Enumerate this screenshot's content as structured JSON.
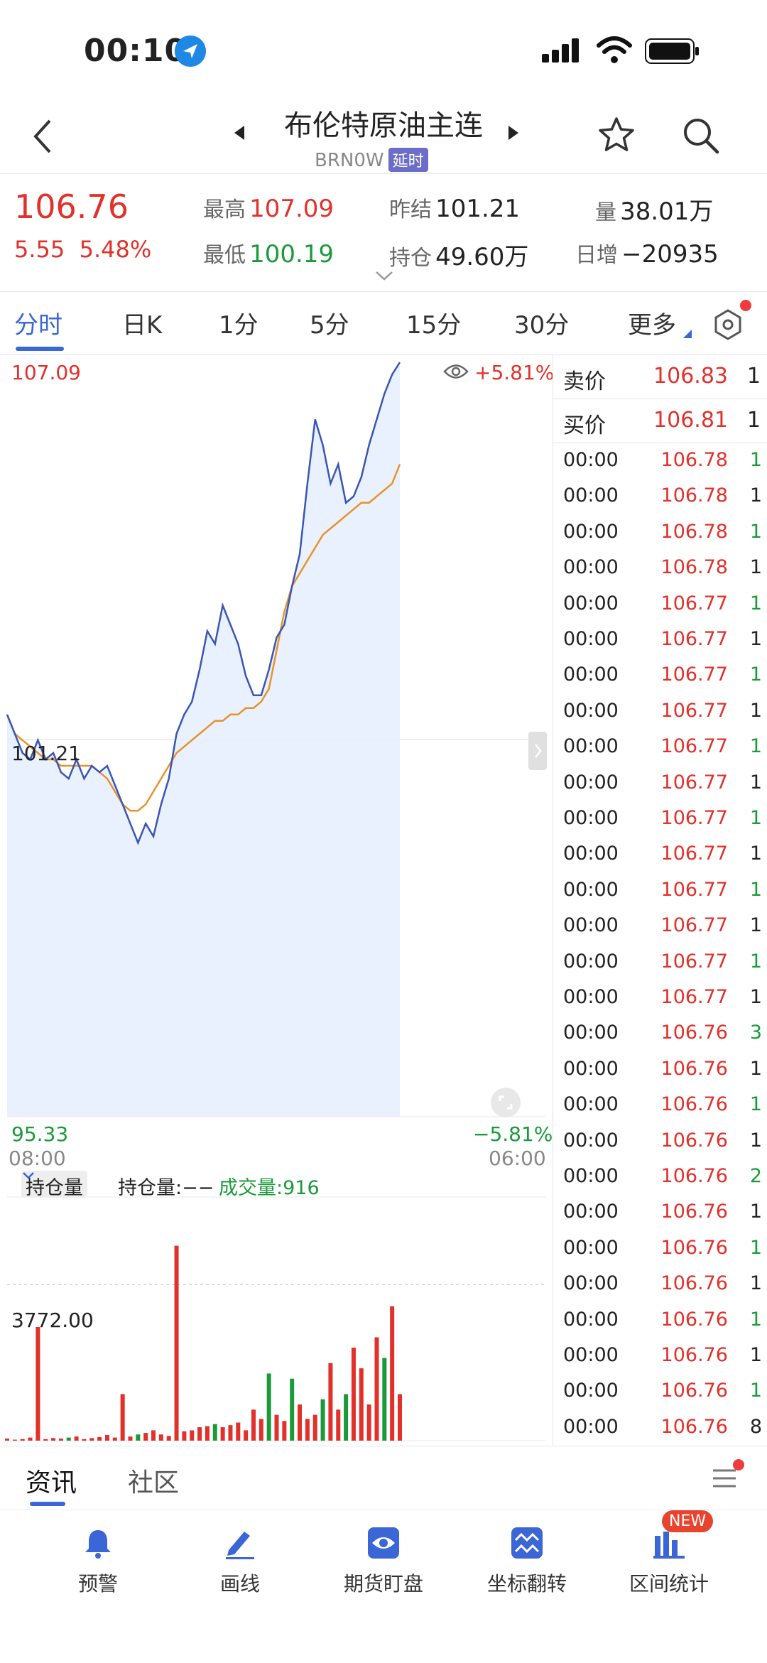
{
  "status": {
    "time": "00:10"
  },
  "header": {
    "title": "布伦特原油主连",
    "code": "BRN0W",
    "badge": "延时"
  },
  "quote": {
    "last": "106.76",
    "change": "5.55",
    "change_pct": "5.48%",
    "high_label": "最高",
    "high": "107.09",
    "low_label": "最低",
    "low": "100.19",
    "prev_label": "昨结",
    "prev": "101.21",
    "oi_label": "持仓",
    "oi": "49.60万",
    "vol_label": "量",
    "vol": "38.01万",
    "dinc_label": "日增",
    "dinc": "−20935"
  },
  "tabs": [
    "分时",
    "日K",
    "1分",
    "5分",
    "15分",
    "30分",
    "更多"
  ],
  "chart": {
    "top_label": "107.09",
    "top_pct": "+5.81%",
    "mid_label": "101.21",
    "bottom_label": "95.33",
    "bottom_pct": "−5.81%",
    "time_start": "08:00",
    "time_end": "06:00",
    "vol_selector": "持仓量",
    "oi_text": "持仓量:−−",
    "vol_text": "成交量:916",
    "vol_ref": "3772.00"
  },
  "chart_data": {
    "type": "line",
    "y_range": [
      95.33,
      107.09
    ],
    "prev_close": 101.21,
    "series": [
      {
        "values": [
          101.6,
          101.3,
          101.0,
          100.9,
          101.2,
          100.9,
          101.0,
          100.7,
          100.6,
          100.9,
          100.6,
          100.8,
          100.7,
          100.8,
          100.5,
          100.2,
          99.9,
          99.6,
          99.9,
          99.7,
          100.2,
          100.6,
          101.3,
          101.6,
          101.8,
          102.3,
          102.9,
          102.7,
          103.3,
          103.0,
          102.7,
          102.2,
          101.9,
          101.9,
          102.3,
          102.8,
          103.0,
          103.6,
          104.1,
          105.2,
          106.2,
          105.8,
          105.2,
          105.5,
          104.9,
          105.0,
          105.3,
          105.8,
          106.2,
          106.6,
          106.9,
          107.09
        ]
      },
      {
        "values": [
          101.6,
          101.3,
          101.2,
          101.1,
          101.0,
          100.9,
          100.9,
          100.8,
          100.8,
          100.8,
          100.8,
          100.8,
          100.7,
          100.6,
          100.4,
          100.2,
          100.1,
          100.1,
          100.2,
          100.4,
          100.6,
          100.8,
          101.0,
          101.1,
          101.2,
          101.3,
          101.4,
          101.5,
          101.5,
          101.6,
          101.6,
          101.7,
          101.7,
          101.8,
          102.0,
          102.6,
          103.2,
          103.6,
          103.8,
          104.0,
          104.2,
          104.4,
          104.5,
          104.6,
          104.7,
          104.8,
          104.9,
          104.9,
          105.0,
          105.1,
          105.2,
          105.5
        ]
      }
    ],
    "volume": [
      40,
      20,
      30,
      60,
      2200,
      30,
      50,
      40,
      60,
      80,
      30,
      50,
      70,
      110,
      60,
      900,
      80,
      120,
      150,
      200,
      120,
      90,
      3772,
      180,
      200,
      260,
      280,
      320,
      260,
      300,
      350,
      200,
      600,
      420,
      1300,
      500,
      380,
      1200,
      700,
      420,
      500,
      800,
      1500,
      600,
      900,
      1800,
      1400,
      700,
      2000,
      1600,
      2600,
      900
    ],
    "volume_colors": [
      "r",
      "r",
      "r",
      "r",
      "r",
      "r",
      "r",
      "r",
      "g",
      "r",
      "r",
      "r",
      "r",
      "r",
      "r",
      "r",
      "r",
      "g",
      "r",
      "r",
      "r",
      "r",
      "r",
      "r",
      "r",
      "r",
      "r",
      "g",
      "r",
      "r",
      "r",
      "r",
      "r",
      "r",
      "g",
      "r",
      "r",
      "g",
      "r",
      "r",
      "r",
      "g",
      "r",
      "r",
      "g",
      "r",
      "r",
      "r",
      "r",
      "g",
      "r",
      "r"
    ]
  },
  "trades": {
    "ask": {
      "label": "卖价",
      "price": "106.83",
      "vol": "1"
    },
    "bid": {
      "label": "买价",
      "price": "106.81",
      "vol": "1"
    },
    "rows": [
      {
        "t": "00:00",
        "p": "106.78",
        "v": "1"
      },
      {
        "t": "00:00",
        "p": "106.78",
        "v": "1"
      },
      {
        "t": "00:00",
        "p": "106.78",
        "v": "1"
      },
      {
        "t": "00:00",
        "p": "106.78",
        "v": "1"
      },
      {
        "t": "00:00",
        "p": "106.77",
        "v": "1"
      },
      {
        "t": "00:00",
        "p": "106.77",
        "v": "1"
      },
      {
        "t": "00:00",
        "p": "106.77",
        "v": "1"
      },
      {
        "t": "00:00",
        "p": "106.77",
        "v": "1"
      },
      {
        "t": "00:00",
        "p": "106.77",
        "v": "1"
      },
      {
        "t": "00:00",
        "p": "106.77",
        "v": "1"
      },
      {
        "t": "00:00",
        "p": "106.77",
        "v": "1"
      },
      {
        "t": "00:00",
        "p": "106.77",
        "v": "1"
      },
      {
        "t": "00:00",
        "p": "106.77",
        "v": "1"
      },
      {
        "t": "00:00",
        "p": "106.77",
        "v": "1"
      },
      {
        "t": "00:00",
        "p": "106.77",
        "v": "1"
      },
      {
        "t": "00:00",
        "p": "106.77",
        "v": "1"
      },
      {
        "t": "00:00",
        "p": "106.76",
        "v": "3"
      },
      {
        "t": "00:00",
        "p": "106.76",
        "v": "1"
      },
      {
        "t": "00:00",
        "p": "106.76",
        "v": "1"
      },
      {
        "t": "00:00",
        "p": "106.76",
        "v": "1"
      },
      {
        "t": "00:00",
        "p": "106.76",
        "v": "2"
      },
      {
        "t": "00:00",
        "p": "106.76",
        "v": "1"
      },
      {
        "t": "00:00",
        "p": "106.76",
        "v": "1"
      },
      {
        "t": "00:00",
        "p": "106.76",
        "v": "1"
      },
      {
        "t": "00:00",
        "p": "106.76",
        "v": "1"
      },
      {
        "t": "00:00",
        "p": "106.76",
        "v": "1"
      },
      {
        "t": "00:00",
        "p": "106.76",
        "v": "1"
      },
      {
        "t": "00:00",
        "p": "106.76",
        "v": "8"
      }
    ]
  },
  "newsbar": {
    "tab1": "资讯",
    "tab2": "社区"
  },
  "toolbar": {
    "items": [
      "预警",
      "画线",
      "期货盯盘",
      "坐标翻转",
      "区间统计"
    ],
    "new_badge": "NEW"
  },
  "colors": {
    "up": "#e2302a",
    "down": "#1a9a3a",
    "accent": "#3a66d6",
    "line": "#3a55b5",
    "avg": "#e8922a"
  }
}
